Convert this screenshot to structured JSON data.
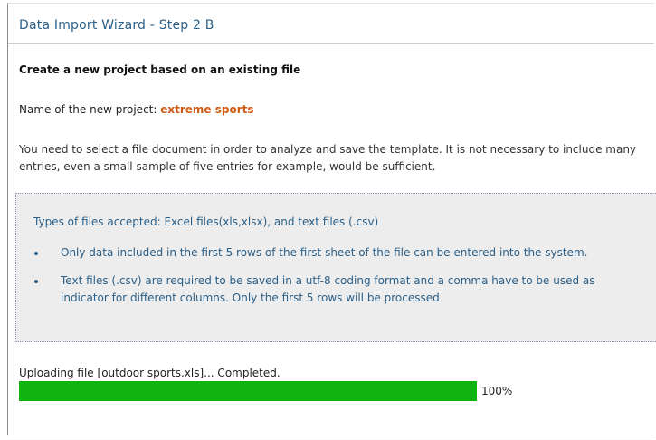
{
  "wizard": {
    "title": "Data Import Wizard - Step 2 B",
    "heading": "Create a new project based on an existing file",
    "project_label": "Name of the new project: ",
    "project_name": "extreme sports",
    "description": "You need to select a file document in order to analyze and save the template. It is not necessary to include many entries, even a small sample of five entries for example, would be sufficient."
  },
  "info": {
    "title": "Types of files accepted: Excel files(xls,xlsx), and text files (.csv)",
    "bullets": [
      "Only data included in the first 5 rows of the first sheet of the file can be entered into the system.",
      "Text files (.csv) are required to be saved in a utf-8 coding format and a comma have to be used as indicator for different columns. Only the first 5 rows will be processed"
    ]
  },
  "upload": {
    "status_text": "Uploading file [outdoor sports.xls]... Completed.",
    "progress_fraction": 1.0,
    "progress_label": "100%"
  },
  "colors": {
    "title": "#2b5f87",
    "project_name": "#d05a12",
    "progress_fill": "#10b410",
    "info_background": "#ededed"
  }
}
